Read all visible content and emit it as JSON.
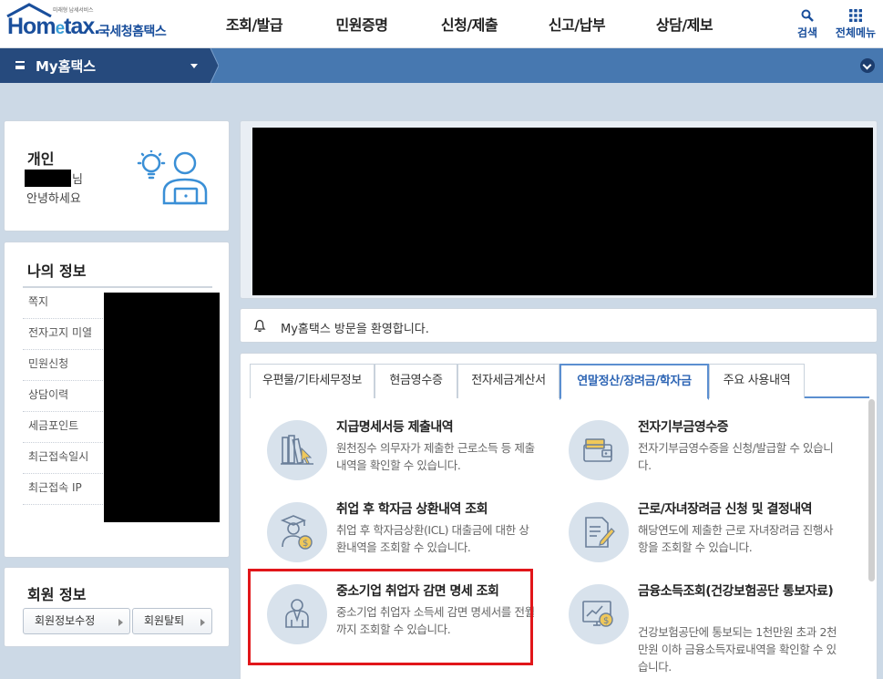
{
  "header": {
    "logo_small": "미래형 납세서비스",
    "logo_word_a": "Hom",
    "logo_word_e": "e",
    "logo_word_b": "tax.",
    "logo_korean": "국세청홈택스",
    "nav": [
      "조회/발급",
      "민원증명",
      "신청/제출",
      "신고/납부",
      "상담/제보"
    ],
    "search_label": "검색",
    "all_menu_label": "전체메뉴"
  },
  "mybar": {
    "title": "My홈택스"
  },
  "profile": {
    "type": "개인",
    "suffix": "님",
    "greeting": "안녕하세요"
  },
  "my_info": {
    "title": "나의 정보",
    "items": [
      "쪽지",
      "전자고지 미열",
      "민원신청",
      "상담이력",
      "세금포인트",
      "최근접속일시",
      "최근접속 IP"
    ]
  },
  "member": {
    "title": "회원 정보",
    "edit_label": "회원정보수정",
    "withdraw_label": "회원탈퇴"
  },
  "notice": {
    "text": "My홈택스 방문을 환영합니다."
  },
  "tabs": [
    "우편물/기타세무정보",
    "현금영수증",
    "전자세금계산서",
    "연말정산/장려금/학자금",
    "주요 사용내역"
  ],
  "active_tab_index": 3,
  "cards": [
    {
      "title": "지급명세서등 제출내역",
      "desc": "원천징수 의무자가 제출한 근로소득 등 제출내역을 확인할 수 있습니다.",
      "icon": "books-cursor-icon"
    },
    {
      "title": "전자기부금영수증",
      "desc": "전자기부금영수증을 신청/발급할 수 있습니다.",
      "icon": "wallet-icon"
    },
    {
      "title": "취업 후 학자금 상환내역 조회",
      "desc": "취업 후 학자금상환(ICL) 대출금에 대한 상환내역을 조회할 수 있습니다.",
      "icon": "graduate-coin-icon"
    },
    {
      "title": "근로/자녀장려금 신청 및 결정내역",
      "desc": "해당연도에 제출한 근로 자녀장려금 진행사항을 조회할 수 있습니다.",
      "icon": "document-pen-icon"
    },
    {
      "title": "중소기업 취업자 감면 명세 조회",
      "desc": "중소기업 취업자 소득세 감면 명세서를 전월까지 조회할 수 있습니다.",
      "icon": "worker-icon"
    },
    {
      "title": "금융소득조회(건강보험공단 통보자료)",
      "desc": "건강보험공단에 통보되는 1천만원 초과 2천만원 이하 금융소득자료내역을 확인할 수 있습니다.",
      "icon": "monitor-coin-icon"
    }
  ],
  "colors": {
    "brand": "#1a4f9c",
    "bar": "#4778b0",
    "bar_dark": "#264a7d",
    "active_tab": "#2c64b4",
    "highlight": "#e1161a",
    "page_bg": "#ccd9e6"
  }
}
